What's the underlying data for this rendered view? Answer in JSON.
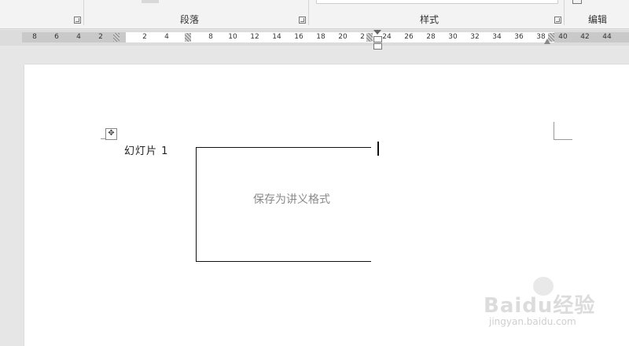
{
  "ribbon": {
    "groups": [
      {
        "name": "paragraph",
        "label": "段落"
      },
      {
        "name": "styles",
        "label": "样式"
      },
      {
        "name": "editing",
        "label": "编辑"
      }
    ]
  },
  "ruler": {
    "left_ticks": [
      "8",
      "6",
      "4",
      "2"
    ],
    "right_ticks": [
      "2",
      "4",
      "8",
      "10",
      "12",
      "14",
      "16",
      "18",
      "20",
      "2",
      "24",
      "26",
      "28",
      "30",
      "32",
      "34",
      "36",
      "38",
      "40",
      "42",
      "44"
    ]
  },
  "document": {
    "slide_label": "幻灯片 1",
    "slide_text": "保存为讲义格式"
  },
  "watermark": {
    "logo": "Baidu经验",
    "url": "jingyan.baidu.com"
  }
}
